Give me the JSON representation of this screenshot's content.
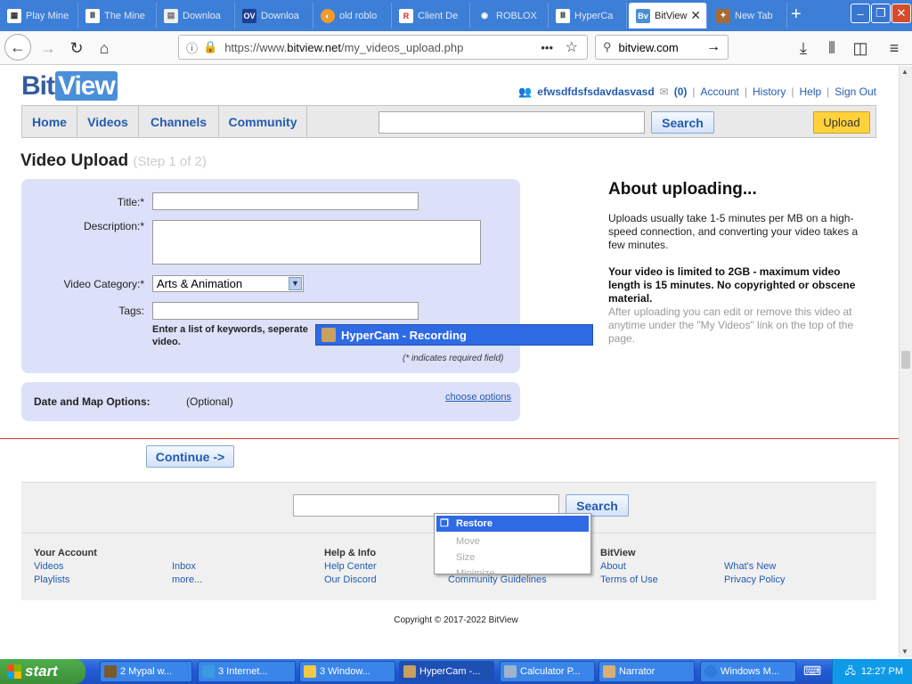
{
  "browser": {
    "tabs": [
      {
        "title": "Play Mine",
        "icon": "grid-icon"
      },
      {
        "title": "The Mine",
        "icon": "building-icon"
      },
      {
        "title": "Downloa",
        "icon": "page-icon"
      },
      {
        "title": "Downloa",
        "icon": "ov-icon"
      },
      {
        "title": "old roblo",
        "icon": "opera-icon"
      },
      {
        "title": "Client De",
        "icon": "roblox-icon"
      },
      {
        "title": "ROBLOX",
        "icon": "eye-icon"
      },
      {
        "title": "HyperCa",
        "icon": "building-icon"
      },
      {
        "title": "BitView",
        "icon": "bitview-icon"
      },
      {
        "title": "New Tab",
        "icon": "wolf-icon"
      }
    ],
    "active_tab": 8,
    "url_prefix": "https://www.",
    "url_domain": "bitview.net",
    "url_path": "/my_videos_upload.php",
    "search_value": "bitview.com",
    "new_tab": "+",
    "more": "•••"
  },
  "site": {
    "logo_bit": "Bit",
    "logo_view": "View",
    "username": "efwsdfdsfsdavdasvasd",
    "mail_count": "(0)",
    "links": [
      "Account",
      "History",
      "Help",
      "Sign Out"
    ],
    "nav": [
      "Home",
      "Videos",
      "Channels",
      "Community"
    ],
    "search_button": "Search",
    "upload_button": "Upload"
  },
  "upload": {
    "title": "Video Upload",
    "step": "(Step 1 of 2)",
    "title_label": "Title:*",
    "description_label": "Description:*",
    "category_label": "Video Category:*",
    "category_value": "Arts & Animation",
    "tags_label": "Tags:",
    "tags_hint_a": "Enter a list of keywords, seperate",
    "tags_hint_b": "video.",
    "required_note": "(* indicates required field)",
    "date_label": "Date and Map Options:",
    "date_optional": "(Optional)",
    "choose_options": "choose options",
    "continue_button": "Continue ->"
  },
  "about": {
    "title": "About uploading...",
    "p1": "Uploads usually take 1-5 minutes per MB on a high-speed connection, and converting your video takes a few minutes.",
    "p2": "Your video is limited to 2GB - maximum video length is 15 minutes. No copyrighted or obscene material.",
    "p3": "After uploading you can edit or remove this video at anytime under the \"My Videos\" link on the top of the page."
  },
  "hypercam": {
    "title": "HyperCam - Recording"
  },
  "system_menu": [
    "Restore",
    "Move",
    "Size",
    "Minimize"
  ],
  "footer": {
    "search_button": "Search",
    "your_account": "Your Account",
    "account_links": [
      "Videos",
      "Playlists",
      "Inbox",
      "more..."
    ],
    "help_info": "Help & Info",
    "help_links": [
      "Help Center",
      "Our Discord",
      "Community Guidelines"
    ],
    "bitview": "BitView",
    "bitview_links": [
      "About",
      "Terms of Use",
      "What's New",
      "Privacy Policy"
    ],
    "copyright": "Copyright © 2017-2022 BitView"
  },
  "taskbar": {
    "start": "start",
    "items": [
      "2 Mypal w...",
      "3 Internet...",
      "3 Window...",
      "HyperCam -...",
      "Calculator P...",
      "Narrator",
      "Windows M..."
    ],
    "clock": "12:27 PM"
  }
}
